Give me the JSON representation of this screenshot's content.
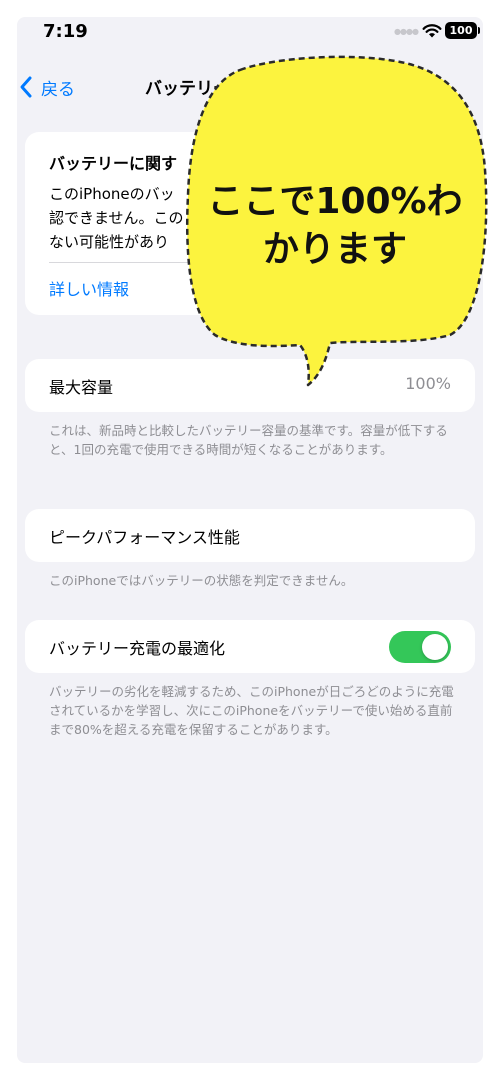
{
  "status_bar": {
    "time": "7:19",
    "battery_level": "100"
  },
  "nav": {
    "back_label": "戻る",
    "title": "バッテリー"
  },
  "info_card": {
    "title": "バッテリーに関す",
    "body_lines": [
      "このiPhoneのバッ",
      "認できません。この",
      "ない可能性があり"
    ],
    "link": "詳しい情報"
  },
  "max_capacity": {
    "label": "最大容量",
    "value": "100%",
    "footer": "これは、新品時と比較したバッテリー容量の基準です。容量が低下すると、1回の充電で使用できる時間が短くなることがあります。"
  },
  "peak_performance": {
    "label": "ピークパフォーマンス性能",
    "footer": "このiPhoneではバッテリーの状態を判定できません。"
  },
  "charging_optimization": {
    "label": "バッテリー充電の最適化",
    "enabled": true,
    "footer": "バッテリーの劣化を軽減するため、このiPhoneが日ごろどのように充電されているかを学習し、次にこのiPhoneをバッテリーで使い始める直前まで80%を超える充電を保留することがあります。"
  },
  "annotation": {
    "line1": "ここで100%わ",
    "line2": "かります",
    "bubble_color": "#fcf33e"
  }
}
